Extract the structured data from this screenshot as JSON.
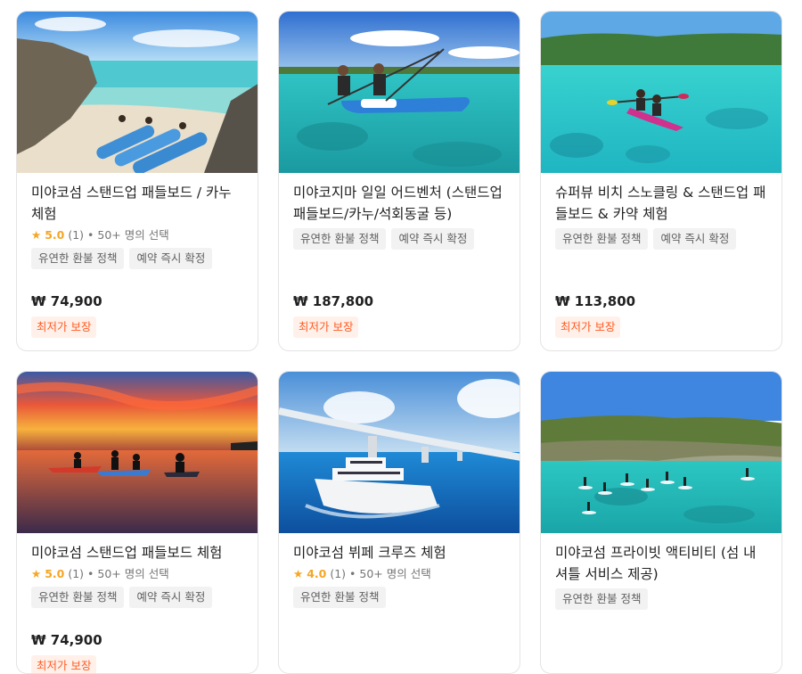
{
  "cards": [
    {
      "title": "미야코섬 스탠드업 패들보드 / 카누 체험",
      "rating": {
        "star": "★",
        "score": "5.0",
        "count": "(1)",
        "popularity": "• 50+ 명의 선택"
      },
      "chips": [
        "유연한 환불 정책",
        "예약 즉시 확정"
      ],
      "price": "₩ 74,900",
      "badge": "최저가 보장"
    },
    {
      "title": "미야코지마 일일 어드벤처 (스탠드업 패들보드/카누/석회동굴 등)",
      "chips": [
        "유연한 환불 정책",
        "예약 즉시 확정"
      ],
      "price": "₩ 187,800",
      "badge": "최저가 보장"
    },
    {
      "title": "슈퍼뷰 비치 스노클링 & 스탠드업 패들보드 & 카약 체험",
      "chips": [
        "유연한 환불 정책",
        "예약 즉시 확정"
      ],
      "price": "₩ 113,800",
      "badge": "최저가 보장"
    },
    {
      "title": "미야코섬 스탠드업 패들보드 체험",
      "rating": {
        "star": "★",
        "score": "5.0",
        "count": "(1)",
        "popularity": "• 50+ 명의 선택"
      },
      "chips": [
        "유연한 환불 정책",
        "예약 즉시 확정"
      ],
      "price": "₩ 74,900",
      "badge": "최저가 보장"
    },
    {
      "title": "미야코섬 뷔페 크루즈 체험",
      "rating": {
        "star": "★",
        "score": "4.0",
        "count": "(1)",
        "popularity": "• 50+ 명의 선택"
      },
      "chips": [
        "유연한 환불 정책"
      ]
    },
    {
      "title": "미야코섬 프라이빗 액티비티 (섬 내 셔틀 서비스 제공)",
      "chips": [
        "유연한 환불 정책"
      ]
    }
  ],
  "colors": {
    "accent": "#ff5b24",
    "star": "#f5a623",
    "chip_bg": "#f2f2f2",
    "badge_bg": "#fff1ea"
  }
}
